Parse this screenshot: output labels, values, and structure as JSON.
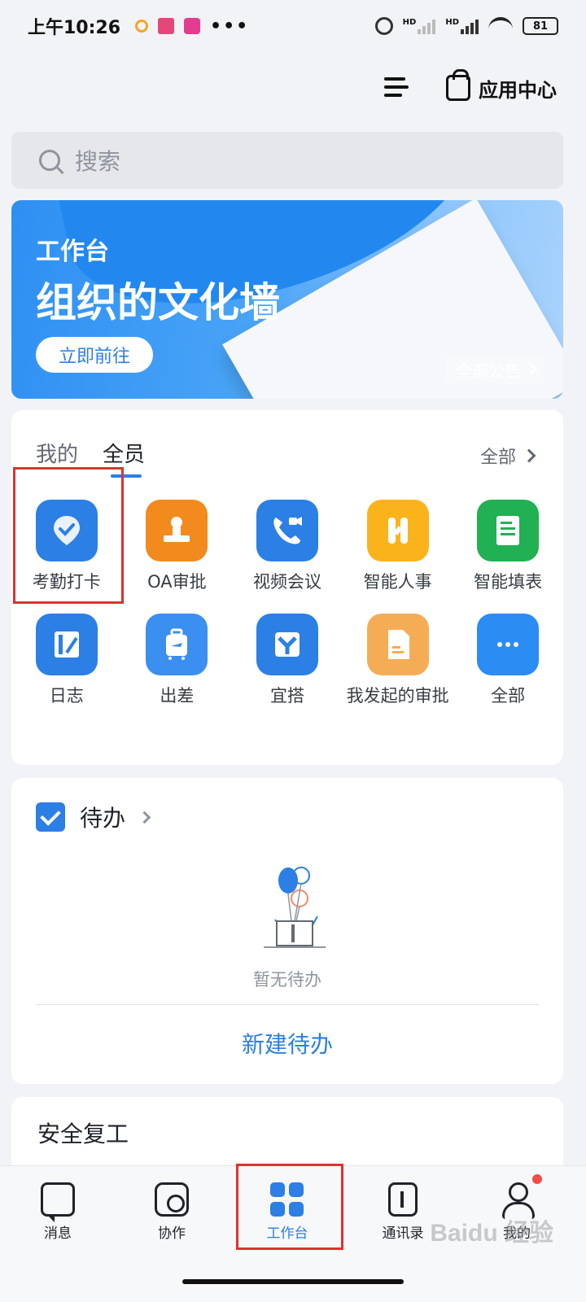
{
  "status_bar": {
    "time": "上午10:26",
    "battery": "81",
    "signal_label_1": "HD",
    "signal_label_2": "HD"
  },
  "header": {
    "app_center_label": "应用中心"
  },
  "search": {
    "placeholder": "搜索"
  },
  "banner": {
    "small_title": "工作台",
    "big_title": "组织的文化墙",
    "go_button": "立即前往",
    "notice_button": "全部公告"
  },
  "apps": {
    "tabs": [
      "我的",
      "全员"
    ],
    "all_link": "全部",
    "items": [
      {
        "label": "考勤打卡",
        "color": "#2b7fe5",
        "icon": "location-check-icon"
      },
      {
        "label": "OA审批",
        "color": "#f28a1e",
        "icon": "stamp-icon"
      },
      {
        "label": "视频会议",
        "color": "#2b7fe5",
        "icon": "video-call-icon"
      },
      {
        "label": "智能人事",
        "color": "#fbb31c",
        "icon": "h-letter-icon"
      },
      {
        "label": "智能填表",
        "color": "#21b052",
        "icon": "form-icon"
      },
      {
        "label": "日志",
        "color": "#2b7fe5",
        "icon": "journal-icon"
      },
      {
        "label": "出差",
        "color": "#3a8ff0",
        "icon": "luggage-icon"
      },
      {
        "label": "宜搭",
        "color": "#2b7fe5",
        "icon": "yida-icon"
      },
      {
        "label": "我发起的审批",
        "color": "#f5ad55",
        "icon": "document-icon"
      },
      {
        "label": "全部",
        "color": "#2b8cf3",
        "icon": "more-dots-icon"
      }
    ]
  },
  "todo": {
    "title": "待办",
    "empty_text": "暂无待办",
    "new_button": "新建待办"
  },
  "safety": {
    "title": "安全复工"
  },
  "bottom_nav": [
    {
      "label": "消息",
      "icon": "message-icon"
    },
    {
      "label": "协作",
      "icon": "collaboration-icon"
    },
    {
      "label": "工作台",
      "icon": "workspace-icon",
      "active": true
    },
    {
      "label": "通讯录",
      "icon": "contacts-icon"
    },
    {
      "label": "我的",
      "icon": "profile-icon"
    }
  ],
  "watermark": "Baidu 经验",
  "colors": {
    "accent": "#2b7fe5",
    "highlight": "#e0312f"
  }
}
